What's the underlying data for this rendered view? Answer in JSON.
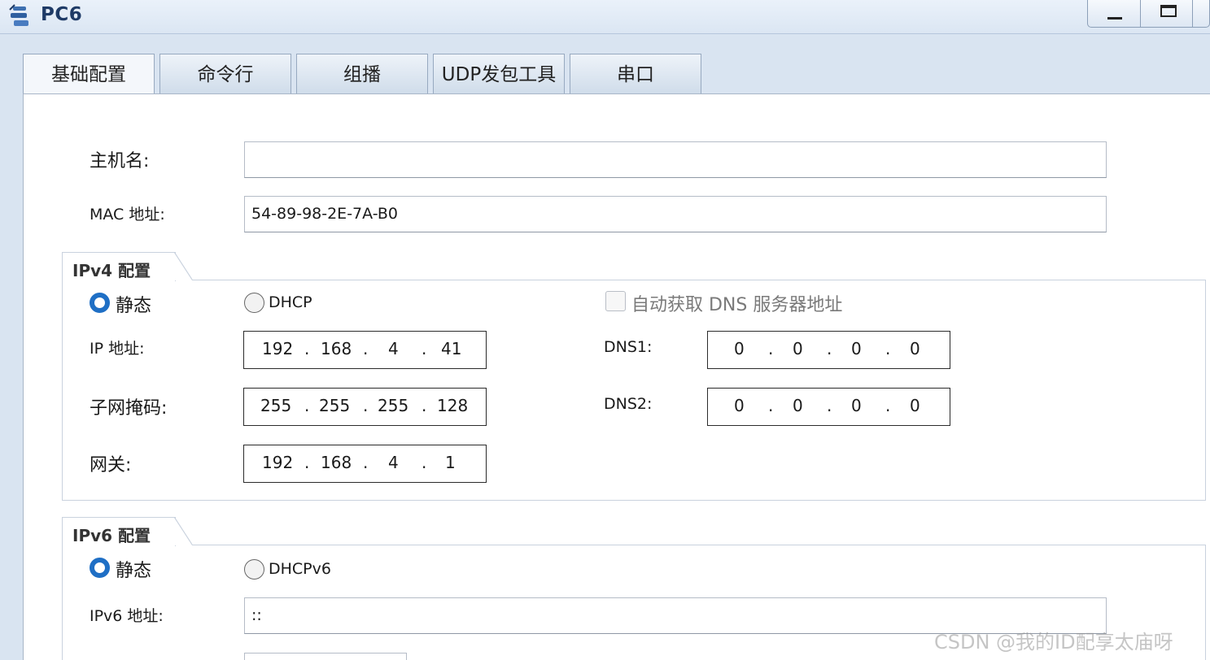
{
  "window": {
    "title": "PC6",
    "icon": "pc-icon",
    "min_icon": "minimize-icon",
    "max_icon": "maximize-icon"
  },
  "tabs": [
    "基础配置",
    "命令行",
    "组播",
    "UDP发包工具",
    "串口"
  ],
  "basic": {
    "hostname_label": "主机名:",
    "hostname_value": "",
    "mac_label": "MAC 地址:",
    "mac_value": "54-89-98-2E-7A-B0"
  },
  "ipv4": {
    "group_title": "IPv4 配置",
    "static_label": "静态",
    "dhcp_label": "DHCP",
    "mode": "static",
    "auto_dns_label": "自动获取 DNS 服务器地址",
    "ip_label": "IP 地址:",
    "ip": [
      "192",
      "168",
      "4",
      "41"
    ],
    "mask_label": "子网掩码:",
    "mask": [
      "255",
      "255",
      "255",
      "128"
    ],
    "gateway_label": "网关:",
    "gateway": [
      "192",
      "168",
      "4",
      "1"
    ],
    "dns1_label": "DNS1:",
    "dns1": [
      "0",
      "0",
      "0",
      "0"
    ],
    "dns2_label": "DNS2:",
    "dns2": [
      "0",
      "0",
      "0",
      "0"
    ],
    "separator": "."
  },
  "ipv6": {
    "group_title": "IPv6 配置",
    "static_label": "静态",
    "dhcp_label": "DHCPv6",
    "mode": "static",
    "addr_label": "IPv6 地址:",
    "addr_value": "::"
  },
  "watermark": "CSDN @我的ID配享太庙呀",
  "colors": {
    "accent": "#1f6fc5",
    "title": "#1e3a66",
    "background": "#d9e4f1"
  }
}
